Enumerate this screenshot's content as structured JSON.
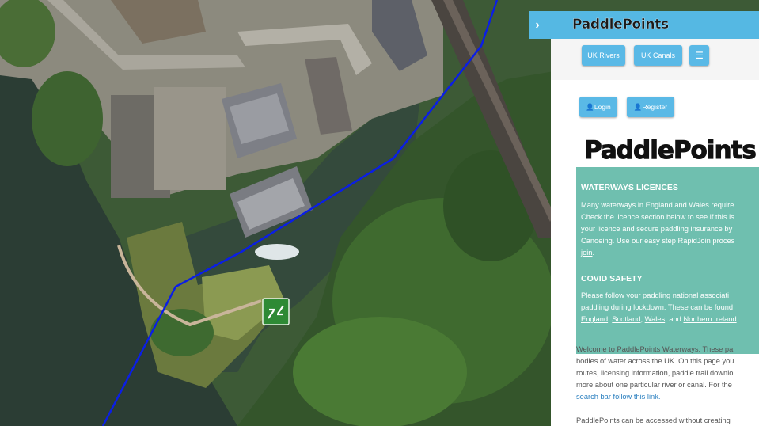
{
  "panel": {
    "collapse_icon": "chevron-right-icon",
    "header_logo": "PaddlePoints",
    "buttons": {
      "rivers": "UK Rivers",
      "canals": "UK Canals",
      "menu_icon": "hamburger-menu-icon"
    },
    "auth": {
      "login": "Login",
      "register": "Register",
      "user_icon": "user-icon"
    },
    "logo": "PaddlePoints",
    "notice": {
      "title1": "WATERWAYS LICENCES",
      "text1_a": "Many waterways in England and Wales require",
      "text1_b": "Check the licence section below to see if this is",
      "text1_c": "your licence and secure paddling insurance by",
      "text1_d": "Canoeing. Use our easy step RapidJoin proces",
      "text1_link": "join",
      "title2": "COVID SAFETY",
      "text2_a": "Please follow your paddling national associati",
      "text2_b": "paddling during lockdown. These can be found",
      "link_england": "England",
      "link_scotland": "Scotland",
      "link_wales": "Wales",
      "and_word": "and",
      "link_ni": "Northern Ireland"
    },
    "welcome": {
      "line1": "Welcome to PaddlePoints Waterways. These pa",
      "line2": "bodies of water across the UK. On this page you",
      "line3": "routes, licensing information, paddle trail downlo",
      "line4": "more about one particular river or canal. For the",
      "line5_link": "search bar follow this link.",
      "line6": "PaddlePoints can be accessed without creating"
    }
  },
  "map": {
    "marker_icon": "lock-weir-icon",
    "route_color": "#0a1ee6"
  },
  "colors": {
    "header": "#55b8e3",
    "button": "#5ab9e6",
    "notice": "#6fbfaf"
  }
}
